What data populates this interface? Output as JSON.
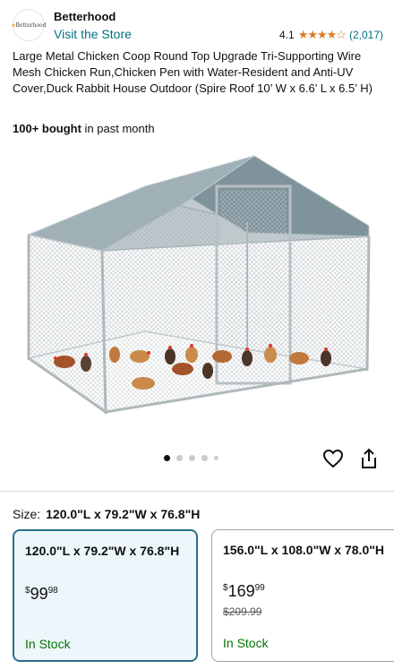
{
  "store": {
    "logo_text": "Betterhood",
    "name": "Betterhood",
    "link": "Visit the Store",
    "rating": "4.1",
    "stars": "★★★★☆",
    "rating_count": "(2,017)"
  },
  "product": {
    "title": "Large Metal Chicken Coop Round Top Upgrade Tri-Supporting Wire Mesh Chicken Run,Chicken Pen with Water-Resident and Anti-UV Cover,Duck Rabbit House Outdoor (Spire Roof 10’ W x 6.6’ L x 6.5’ H)",
    "bought_bold": "100+ bought",
    "bought_rest": " in past month"
  },
  "gallery": {
    "dots": 5,
    "active_index": 0
  },
  "icons": {
    "heart": "heart-icon",
    "share": "share-icon"
  },
  "size": {
    "label": "Size:",
    "selected_value": "120.0\"L x 79.2\"W x 76.8\"H"
  },
  "options": [
    {
      "size": "120.0\"L x 79.2\"W x 76.8\"H",
      "price_dollar": "$",
      "price_whole": "99",
      "price_fraction": "98",
      "list_price": "",
      "stock": "In Stock",
      "selected": true
    },
    {
      "size": "156.0\"L x 108.0\"W x 78.0\"H",
      "price_dollar": "$",
      "price_whole": "169",
      "price_fraction": "99",
      "list_price": "$209.99",
      "stock": "In Stock",
      "selected": false
    }
  ],
  "colors": {
    "link": "#007185",
    "star": "#de7921",
    "stock": "#007600",
    "selected_border": "#2b6f8c",
    "selected_bg": "#edf6fa",
    "roof": "#8fa0a8"
  }
}
